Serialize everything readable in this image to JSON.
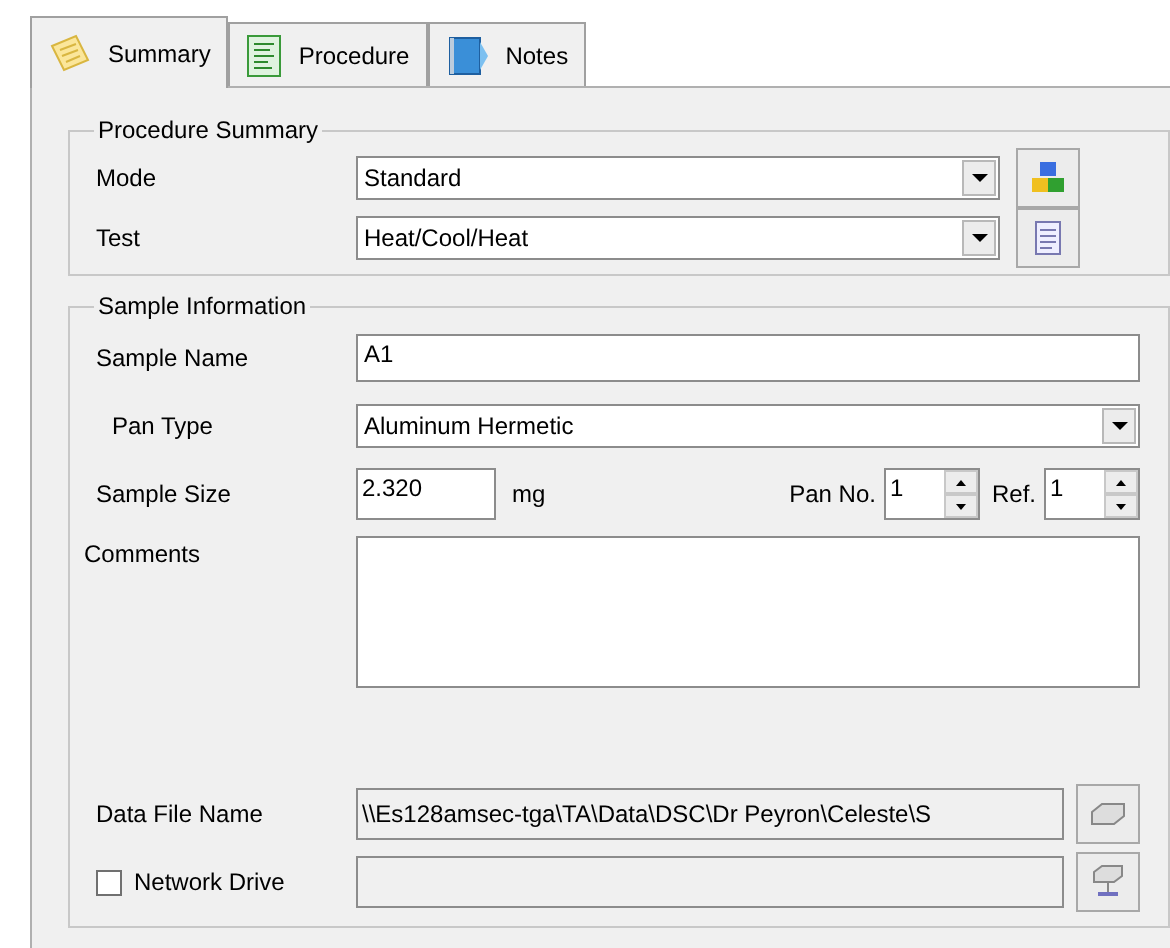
{
  "tabs": [
    {
      "label": "Summary",
      "selected": true,
      "kind": "note"
    },
    {
      "label": "Procedure",
      "selected": false,
      "kind": "list"
    },
    {
      "label": "Notes",
      "selected": false,
      "kind": "book"
    }
  ],
  "procedure_summary": {
    "title": "Procedure Summary",
    "mode": {
      "label": "Mode",
      "value": "Standard"
    },
    "test": {
      "label": "Test",
      "value": "Heat/Cool/Heat"
    }
  },
  "sample_information": {
    "title": "Sample Information",
    "sample_name": {
      "label": "Sample Name",
      "value": "A1"
    },
    "pan_type": {
      "label": "Pan Type",
      "value": "Aluminum Hermetic"
    },
    "sample_size": {
      "label": "Sample Size",
      "value": "2.320",
      "unit": "mg"
    },
    "pan_no": {
      "label": "Pan No.",
      "value": "1"
    },
    "ref": {
      "label": "Ref.",
      "value": "1"
    },
    "comments": {
      "label": "Comments"
    },
    "data_file_name": {
      "label": "Data File Name",
      "value": "\\\\Es128amsec-tga\\TA\\Data\\DSC\\Dr Peyron\\Celeste\\S"
    },
    "network_drive": {
      "label": "Network Drive",
      "checked": false
    }
  }
}
